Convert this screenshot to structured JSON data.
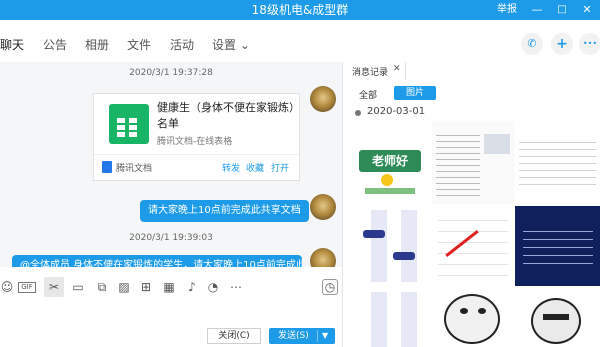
{
  "window": {
    "title": "18级机电&成型群",
    "report_label": "举报",
    "min_glyph": "—",
    "max_glyph": "□",
    "close_glyph": "✕"
  },
  "tabs": [
    {
      "label": "聊天"
    },
    {
      "label": "公告"
    },
    {
      "label": "相册"
    },
    {
      "label": "文件"
    },
    {
      "label": "活动"
    },
    {
      "label": "设置 ⌄"
    }
  ],
  "header_actions": {
    "call_glyph": "✆",
    "add_glyph": "+",
    "more_glyph": "•••"
  },
  "chat": {
    "timestamp1": "2020/3/1 19:37:28",
    "card": {
      "file_name": "健康生（身体不便在家锻炼）名单",
      "file_desc": "腾讯文档-在线表格",
      "brand": "腾讯文档",
      "actions": [
        "转发",
        "收藏",
        "打开"
      ]
    },
    "bubble1": "请大家晚上10点前完成此共享文档",
    "timestamp2": "2020/3/1 19:39:03",
    "bubble2": "@全体成员 身体不便在家锻炼的学生，请大家晚上10点前完成此"
  },
  "toolbar": {
    "tools": [
      {
        "name": "emoji-icon",
        "glyph": "☺"
      },
      {
        "name": "gif-icon",
        "glyph": "GIF"
      },
      {
        "name": "scissors-icon",
        "glyph": "✂"
      },
      {
        "name": "folder-icon",
        "glyph": "▭"
      },
      {
        "name": "screen-icon",
        "glyph": "⧉"
      },
      {
        "name": "image-icon",
        "glyph": "▨"
      },
      {
        "name": "gift-icon",
        "glyph": "⊞"
      },
      {
        "name": "calendar-icon",
        "glyph": "▦"
      },
      {
        "name": "mic-icon",
        "glyph": "♪"
      },
      {
        "name": "bell-icon",
        "glyph": "◔"
      },
      {
        "name": "grid-icon",
        "glyph": "⋯"
      }
    ],
    "history_glyph": "◷"
  },
  "buttons": {
    "close_label": "关闭(C)",
    "send_label": "发送(S)",
    "send_arrow": "▼"
  },
  "history": {
    "tab_label": "消息记录",
    "tab_close": "✕",
    "filter_all": "全部",
    "filter_images": "图片",
    "date": "2020-03-01",
    "thumb_banner": "老师好"
  }
}
